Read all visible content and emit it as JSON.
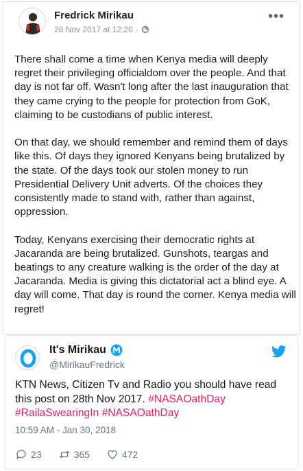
{
  "post": {
    "author": "Fredrick Mirikau",
    "timestamp": "28 Nov 2017 at 12:20",
    "separator": "·",
    "privacy_icon": "globe-icon",
    "more_icon": "more-options-icon",
    "more_label": "•••",
    "paragraphs": [
      "There shall come a time when Kenya media will deeply regret their privileging officialdom over the people. And that day is not far off. Wasn't long after the last inauguration that they came crying to the people for protection from GoK, claiming to be custodians of public interest.",
      "On that day, we should remember and remind them of days like this. Of days they ignored Kenyans being brutalized by the state. Of the days took our stolen money to run Presidential Delivery Unit adverts. Of the choices they consistently made to stand with, rather than against, oppression.",
      "Today, Kenyans exercising their democratic rights at Jacaranda are being brutalized. Gunshots, teargas and beatings to any creature walking is the order of the day at Jacaranda. Media is giving this dictatorial act a blind eye. A day will come. That day is round the corner. Kenya media will regret!"
    ]
  },
  "tweet": {
    "display_name": "It's Mirikau",
    "handle": "@MirikauFredrick",
    "verified_icon": "m-logo-icon",
    "bird_icon": "twitter-bird-icon",
    "text_plain": "KTN News, Citizen Tv and Radio you should have read this post on 28th Nov 2017. ",
    "hashtags": [
      "#NASAOathDay",
      "#RailaSwearingIn",
      "#NASAOathDay"
    ],
    "time": "10:59 AM - Jan 30, 2018",
    "replies": "23",
    "retweets": "365",
    "likes": "472"
  },
  "colors": {
    "hashtag": "#e0245e",
    "twitter_blue": "#1da1f2",
    "meta_grey": "#90949c"
  }
}
